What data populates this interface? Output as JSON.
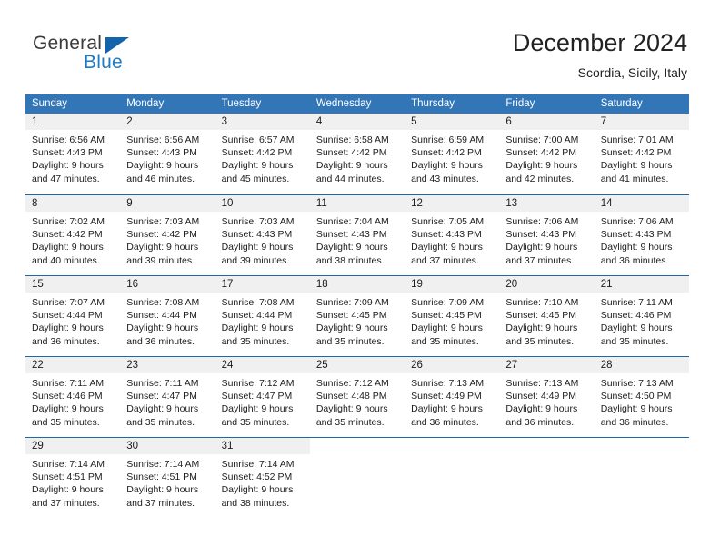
{
  "brand": {
    "name_top": "General",
    "name_bottom": "Blue",
    "triangle_color": "#1464ab",
    "blue_color": "#1f7ac4"
  },
  "header": {
    "title": "December 2024",
    "subtitle": "Scordia, Sicily, Italy"
  },
  "theme": {
    "header_blue": "#3276b8",
    "row_divider_blue": "#1d67ab",
    "daynum_strip": "#f0f0f0"
  },
  "weekdays": [
    "Sunday",
    "Monday",
    "Tuesday",
    "Wednesday",
    "Thursday",
    "Friday",
    "Saturday"
  ],
  "weeks": [
    [
      {
        "day": "1",
        "sunrise": "Sunrise: 6:56 AM",
        "sunset": "Sunset: 4:43 PM",
        "daylight1": "Daylight: 9 hours",
        "daylight2": "and 47 minutes."
      },
      {
        "day": "2",
        "sunrise": "Sunrise: 6:56 AM",
        "sunset": "Sunset: 4:43 PM",
        "daylight1": "Daylight: 9 hours",
        "daylight2": "and 46 minutes."
      },
      {
        "day": "3",
        "sunrise": "Sunrise: 6:57 AM",
        "sunset": "Sunset: 4:42 PM",
        "daylight1": "Daylight: 9 hours",
        "daylight2": "and 45 minutes."
      },
      {
        "day": "4",
        "sunrise": "Sunrise: 6:58 AM",
        "sunset": "Sunset: 4:42 PM",
        "daylight1": "Daylight: 9 hours",
        "daylight2": "and 44 minutes."
      },
      {
        "day": "5",
        "sunrise": "Sunrise: 6:59 AM",
        "sunset": "Sunset: 4:42 PM",
        "daylight1": "Daylight: 9 hours",
        "daylight2": "and 43 minutes."
      },
      {
        "day": "6",
        "sunrise": "Sunrise: 7:00 AM",
        "sunset": "Sunset: 4:42 PM",
        "daylight1": "Daylight: 9 hours",
        "daylight2": "and 42 minutes."
      },
      {
        "day": "7",
        "sunrise": "Sunrise: 7:01 AM",
        "sunset": "Sunset: 4:42 PM",
        "daylight1": "Daylight: 9 hours",
        "daylight2": "and 41 minutes."
      }
    ],
    [
      {
        "day": "8",
        "sunrise": "Sunrise: 7:02 AM",
        "sunset": "Sunset: 4:42 PM",
        "daylight1": "Daylight: 9 hours",
        "daylight2": "and 40 minutes."
      },
      {
        "day": "9",
        "sunrise": "Sunrise: 7:03 AM",
        "sunset": "Sunset: 4:42 PM",
        "daylight1": "Daylight: 9 hours",
        "daylight2": "and 39 minutes."
      },
      {
        "day": "10",
        "sunrise": "Sunrise: 7:03 AM",
        "sunset": "Sunset: 4:43 PM",
        "daylight1": "Daylight: 9 hours",
        "daylight2": "and 39 minutes."
      },
      {
        "day": "11",
        "sunrise": "Sunrise: 7:04 AM",
        "sunset": "Sunset: 4:43 PM",
        "daylight1": "Daylight: 9 hours",
        "daylight2": "and 38 minutes."
      },
      {
        "day": "12",
        "sunrise": "Sunrise: 7:05 AM",
        "sunset": "Sunset: 4:43 PM",
        "daylight1": "Daylight: 9 hours",
        "daylight2": "and 37 minutes."
      },
      {
        "day": "13",
        "sunrise": "Sunrise: 7:06 AM",
        "sunset": "Sunset: 4:43 PM",
        "daylight1": "Daylight: 9 hours",
        "daylight2": "and 37 minutes."
      },
      {
        "day": "14",
        "sunrise": "Sunrise: 7:06 AM",
        "sunset": "Sunset: 4:43 PM",
        "daylight1": "Daylight: 9 hours",
        "daylight2": "and 36 minutes."
      }
    ],
    [
      {
        "day": "15",
        "sunrise": "Sunrise: 7:07 AM",
        "sunset": "Sunset: 4:44 PM",
        "daylight1": "Daylight: 9 hours",
        "daylight2": "and 36 minutes."
      },
      {
        "day": "16",
        "sunrise": "Sunrise: 7:08 AM",
        "sunset": "Sunset: 4:44 PM",
        "daylight1": "Daylight: 9 hours",
        "daylight2": "and 36 minutes."
      },
      {
        "day": "17",
        "sunrise": "Sunrise: 7:08 AM",
        "sunset": "Sunset: 4:44 PM",
        "daylight1": "Daylight: 9 hours",
        "daylight2": "and 35 minutes."
      },
      {
        "day": "18",
        "sunrise": "Sunrise: 7:09 AM",
        "sunset": "Sunset: 4:45 PM",
        "daylight1": "Daylight: 9 hours",
        "daylight2": "and 35 minutes."
      },
      {
        "day": "19",
        "sunrise": "Sunrise: 7:09 AM",
        "sunset": "Sunset: 4:45 PM",
        "daylight1": "Daylight: 9 hours",
        "daylight2": "and 35 minutes."
      },
      {
        "day": "20",
        "sunrise": "Sunrise: 7:10 AM",
        "sunset": "Sunset: 4:45 PM",
        "daylight1": "Daylight: 9 hours",
        "daylight2": "and 35 minutes."
      },
      {
        "day": "21",
        "sunrise": "Sunrise: 7:11 AM",
        "sunset": "Sunset: 4:46 PM",
        "daylight1": "Daylight: 9 hours",
        "daylight2": "and 35 minutes."
      }
    ],
    [
      {
        "day": "22",
        "sunrise": "Sunrise: 7:11 AM",
        "sunset": "Sunset: 4:46 PM",
        "daylight1": "Daylight: 9 hours",
        "daylight2": "and 35 minutes."
      },
      {
        "day": "23",
        "sunrise": "Sunrise: 7:11 AM",
        "sunset": "Sunset: 4:47 PM",
        "daylight1": "Daylight: 9 hours",
        "daylight2": "and 35 minutes."
      },
      {
        "day": "24",
        "sunrise": "Sunrise: 7:12 AM",
        "sunset": "Sunset: 4:47 PM",
        "daylight1": "Daylight: 9 hours",
        "daylight2": "and 35 minutes."
      },
      {
        "day": "25",
        "sunrise": "Sunrise: 7:12 AM",
        "sunset": "Sunset: 4:48 PM",
        "daylight1": "Daylight: 9 hours",
        "daylight2": "and 35 minutes."
      },
      {
        "day": "26",
        "sunrise": "Sunrise: 7:13 AM",
        "sunset": "Sunset: 4:49 PM",
        "daylight1": "Daylight: 9 hours",
        "daylight2": "and 36 minutes."
      },
      {
        "day": "27",
        "sunrise": "Sunrise: 7:13 AM",
        "sunset": "Sunset: 4:49 PM",
        "daylight1": "Daylight: 9 hours",
        "daylight2": "and 36 minutes."
      },
      {
        "day": "28",
        "sunrise": "Sunrise: 7:13 AM",
        "sunset": "Sunset: 4:50 PM",
        "daylight1": "Daylight: 9 hours",
        "daylight2": "and 36 minutes."
      }
    ],
    [
      {
        "day": "29",
        "sunrise": "Sunrise: 7:14 AM",
        "sunset": "Sunset: 4:51 PM",
        "daylight1": "Daylight: 9 hours",
        "daylight2": "and 37 minutes."
      },
      {
        "day": "30",
        "sunrise": "Sunrise: 7:14 AM",
        "sunset": "Sunset: 4:51 PM",
        "daylight1": "Daylight: 9 hours",
        "daylight2": "and 37 minutes."
      },
      {
        "day": "31",
        "sunrise": "Sunrise: 7:14 AM",
        "sunset": "Sunset: 4:52 PM",
        "daylight1": "Daylight: 9 hours",
        "daylight2": "and 38 minutes."
      },
      {
        "day": "",
        "sunrise": "",
        "sunset": "",
        "daylight1": "",
        "daylight2": ""
      },
      {
        "day": "",
        "sunrise": "",
        "sunset": "",
        "daylight1": "",
        "daylight2": ""
      },
      {
        "day": "",
        "sunrise": "",
        "sunset": "",
        "daylight1": "",
        "daylight2": ""
      },
      {
        "day": "",
        "sunrise": "",
        "sunset": "",
        "daylight1": "",
        "daylight2": ""
      }
    ]
  ]
}
